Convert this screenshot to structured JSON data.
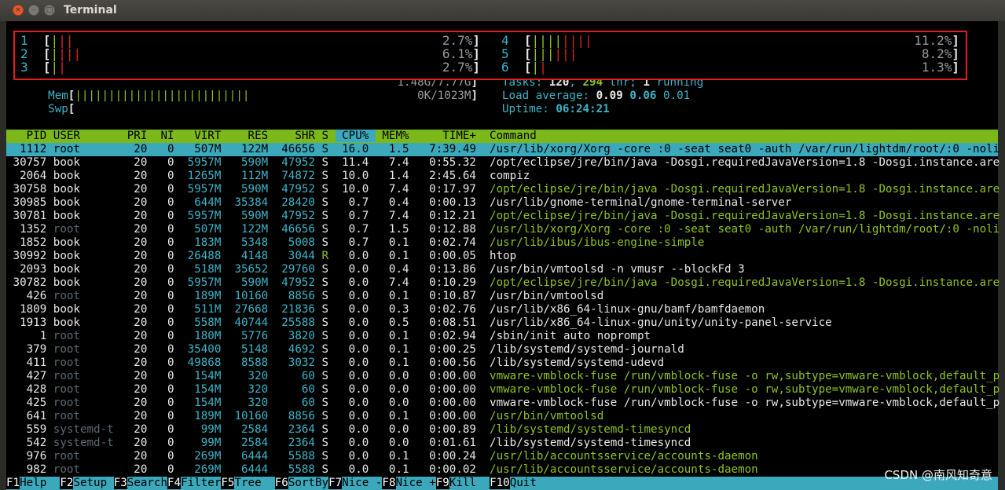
{
  "window": {
    "title": "Terminal",
    "buttons": {
      "close": "×",
      "minimize": "–",
      "maximize": "□"
    }
  },
  "meters": {
    "cpus": [
      {
        "id": "1",
        "bar": "|||",
        "percent": "2.7%"
      },
      {
        "id": "2",
        "bar": "||||",
        "percent": "6.1%"
      },
      {
        "id": "3",
        "bar": "||",
        "percent": "2.7%"
      },
      {
        "id": "4",
        "bar": "||||||||",
        "percent": "11.2%"
      },
      {
        "id": "5",
        "bar": "||||||",
        "percent": "8.2%"
      },
      {
        "id": "6",
        "bar": "||",
        "percent": "1.3%"
      }
    ],
    "mem": {
      "label": "Mem",
      "bar": "||||||||||||||||||||||||||",
      "value": "1.48G/7.77G"
    },
    "swp": {
      "label": "Swp",
      "value": "0K/1023M"
    },
    "tasks": {
      "label": "Tasks: ",
      "count": "120",
      "sep1": ", ",
      "threads": "294",
      "thr_label": " thr; ",
      "running": "1",
      "running_label": " running"
    },
    "load": {
      "label": "Load average: ",
      "l1": "0.09",
      "l5": "0.06",
      "l15": "0.01"
    },
    "uptime": {
      "label": "Uptime: ",
      "value": "06:24:21"
    }
  },
  "columns": [
    "PID",
    "USER",
    "PRI",
    "NI",
    "VIRT",
    "RES",
    "SHR",
    "S",
    "CPU%",
    "MEM%",
    "TIME+",
    "Command"
  ],
  "processes": [
    {
      "pid": "1112",
      "user": "root",
      "pri": "20",
      "ni": "0",
      "virt": "507M",
      "res": "122M",
      "shr": "46656",
      "s": "S",
      "cpu": "16.0",
      "mem": "1.5",
      "time": "7:39.49",
      "cmd": "/usr/lib/xorg/Xorg -core :0 -seat seat0 -auth /var/run/lightdm/root/:0 -noli",
      "kind": "selected"
    },
    {
      "pid": "30757",
      "user": "book",
      "pri": "20",
      "ni": "0",
      "virt": "5957M",
      "res": "590M",
      "shr": "47952",
      "s": "S",
      "cpu": "11.4",
      "mem": "7.4",
      "time": "0:55.32",
      "cmd": "/opt/eclipse/jre/bin/java -Dosgi.requiredJavaVersion=1.8 -Dosgi.instance.are",
      "kind": "normal"
    },
    {
      "pid": "2064",
      "user": "book",
      "pri": "20",
      "ni": "0",
      "virt": "1265M",
      "res": "112M",
      "shr": "74872",
      "s": "S",
      "cpu": "10.0",
      "mem": "1.4",
      "time": "2:45.64",
      "cmd": "compiz",
      "kind": "normal"
    },
    {
      "pid": "30758",
      "user": "book",
      "pri": "20",
      "ni": "0",
      "virt": "5957M",
      "res": "590M",
      "shr": "47952",
      "s": "S",
      "cpu": "10.0",
      "mem": "7.4",
      "time": "0:17.97",
      "cmd": "/opt/eclipse/jre/bin/java -Dosgi.requiredJavaVersion=1.8 -Dosgi.instance.are",
      "kind": "thread"
    },
    {
      "pid": "30985",
      "user": "book",
      "pri": "20",
      "ni": "0",
      "virt": "644M",
      "res": "35384",
      "shr": "28420",
      "s": "S",
      "cpu": "0.7",
      "mem": "0.4",
      "time": "0:00.13",
      "cmd": "/usr/lib/gnome-terminal/gnome-terminal-server",
      "kind": "normal"
    },
    {
      "pid": "30781",
      "user": "book",
      "pri": "20",
      "ni": "0",
      "virt": "5957M",
      "res": "590M",
      "shr": "47952",
      "s": "S",
      "cpu": "0.7",
      "mem": "7.4",
      "time": "0:12.21",
      "cmd": "/opt/eclipse/jre/bin/java -Dosgi.requiredJavaVersion=1.8 -Dosgi.instance.are",
      "kind": "thread"
    },
    {
      "pid": "1352",
      "user": "root",
      "pri": "20",
      "ni": "0",
      "virt": "507M",
      "res": "122M",
      "shr": "46656",
      "s": "S",
      "cpu": "0.7",
      "mem": "1.5",
      "time": "0:12.88",
      "cmd": "/usr/lib/xorg/Xorg -core :0 -seat seat0 -auth /var/run/lightdm/root/:0 -noli",
      "kind": "thread"
    },
    {
      "pid": "1852",
      "user": "book",
      "pri": "20",
      "ni": "0",
      "virt": "183M",
      "res": "5348",
      "shr": "5008",
      "s": "S",
      "cpu": "0.7",
      "mem": "0.1",
      "time": "0:02.74",
      "cmd": "/usr/lib/ibus/ibus-engine-simple",
      "kind": "thread"
    },
    {
      "pid": "30992",
      "user": "book",
      "pri": "20",
      "ni": "0",
      "virt": "26488",
      "res": "4148",
      "shr": "3044",
      "s": "R",
      "cpu": "0.0",
      "mem": "0.1",
      "time": "0:00.05",
      "cmd": "htop",
      "kind": "normal"
    },
    {
      "pid": "2093",
      "user": "book",
      "pri": "20",
      "ni": "0",
      "virt": "518M",
      "res": "35652",
      "shr": "29760",
      "s": "S",
      "cpu": "0.0",
      "mem": "0.4",
      "time": "0:13.86",
      "cmd": "/usr/bin/vmtoolsd -n vmusr --blockFd 3",
      "kind": "normal"
    },
    {
      "pid": "30782",
      "user": "book",
      "pri": "20",
      "ni": "0",
      "virt": "5957M",
      "res": "590M",
      "shr": "47952",
      "s": "S",
      "cpu": "0.0",
      "mem": "7.4",
      "time": "0:10.29",
      "cmd": "/opt/eclipse/jre/bin/java -Dosgi.requiredJavaVersion=1.8 -Dosgi.instance.are",
      "kind": "thread"
    },
    {
      "pid": "426",
      "user": "root",
      "pri": "20",
      "ni": "0",
      "virt": "189M",
      "res": "10160",
      "shr": "8856",
      "s": "S",
      "cpu": "0.0",
      "mem": "0.1",
      "time": "0:10.87",
      "cmd": "/usr/bin/vmtoolsd",
      "kind": "normal"
    },
    {
      "pid": "1809",
      "user": "book",
      "pri": "20",
      "ni": "0",
      "virt": "511M",
      "res": "27668",
      "shr": "21836",
      "s": "S",
      "cpu": "0.0",
      "mem": "0.3",
      "time": "0:02.76",
      "cmd": "/usr/lib/x86_64-linux-gnu/bamf/bamfdaemon",
      "kind": "normal"
    },
    {
      "pid": "1913",
      "user": "book",
      "pri": "20",
      "ni": "0",
      "virt": "558M",
      "res": "40744",
      "shr": "25588",
      "s": "S",
      "cpu": "0.0",
      "mem": "0.5",
      "time": "0:08.51",
      "cmd": "/usr/lib/x86_64-linux-gnu/unity/unity-panel-service",
      "kind": "normal"
    },
    {
      "pid": "1",
      "user": "root",
      "pri": "20",
      "ni": "0",
      "virt": "180M",
      "res": "5776",
      "shr": "3820",
      "s": "S",
      "cpu": "0.0",
      "mem": "0.1",
      "time": "0:02.94",
      "cmd": "/sbin/init auto noprompt",
      "kind": "normal"
    },
    {
      "pid": "379",
      "user": "root",
      "pri": "20",
      "ni": "0",
      "virt": "35400",
      "res": "5148",
      "shr": "4692",
      "s": "S",
      "cpu": "0.0",
      "mem": "0.1",
      "time": "0:00.25",
      "cmd": "/lib/systemd/systemd-journald",
      "kind": "normal"
    },
    {
      "pid": "411",
      "user": "root",
      "pri": "20",
      "ni": "0",
      "virt": "49868",
      "res": "8588",
      "shr": "3032",
      "s": "S",
      "cpu": "0.0",
      "mem": "0.1",
      "time": "0:00.56",
      "cmd": "/lib/systemd/systemd-udevd",
      "kind": "normal"
    },
    {
      "pid": "427",
      "user": "root",
      "pri": "20",
      "ni": "0",
      "virt": "154M",
      "res": "320",
      "shr": "60",
      "s": "S",
      "cpu": "0.0",
      "mem": "0.0",
      "time": "0:00.00",
      "cmd": "vmware-vmblock-fuse /run/vmblock-fuse -o rw,subtype=vmware-vmblock,default_p",
      "kind": "thread"
    },
    {
      "pid": "428",
      "user": "root",
      "pri": "20",
      "ni": "0",
      "virt": "154M",
      "res": "320",
      "shr": "60",
      "s": "S",
      "cpu": "0.0",
      "mem": "0.0",
      "time": "0:00.00",
      "cmd": "vmware-vmblock-fuse /run/vmblock-fuse -o rw,subtype=vmware-vmblock,default_p",
      "kind": "thread"
    },
    {
      "pid": "425",
      "user": "root",
      "pri": "20",
      "ni": "0",
      "virt": "154M",
      "res": "320",
      "shr": "60",
      "s": "S",
      "cpu": "0.0",
      "mem": "0.0",
      "time": "0:00.00",
      "cmd": "vmware-vmblock-fuse /run/vmblock-fuse -o rw,subtype=vmware-vmblock,default_p",
      "kind": "normal"
    },
    {
      "pid": "641",
      "user": "root",
      "pri": "20",
      "ni": "0",
      "virt": "189M",
      "res": "10160",
      "shr": "8856",
      "s": "S",
      "cpu": "0.0",
      "mem": "0.1",
      "time": "0:00.00",
      "cmd": "/usr/bin/vmtoolsd",
      "kind": "thread"
    },
    {
      "pid": "559",
      "user": "systemd-t",
      "pri": "20",
      "ni": "0",
      "virt": "99M",
      "res": "2584",
      "shr": "2364",
      "s": "S",
      "cpu": "0.0",
      "mem": "0.0",
      "time": "0:00.89",
      "cmd": "/lib/systemd/systemd-timesyncd",
      "kind": "thread"
    },
    {
      "pid": "542",
      "user": "systemd-t",
      "pri": "20",
      "ni": "0",
      "virt": "99M",
      "res": "2584",
      "shr": "2364",
      "s": "S",
      "cpu": "0.0",
      "mem": "0.0",
      "time": "0:01.61",
      "cmd": "/lib/systemd/systemd-timesyncd",
      "kind": "normal"
    },
    {
      "pid": "976",
      "user": "root",
      "pri": "20",
      "ni": "0",
      "virt": "269M",
      "res": "6444",
      "shr": "5588",
      "s": "S",
      "cpu": "0.0",
      "mem": "0.1",
      "time": "0:00.24",
      "cmd": "/usr/lib/accountsservice/accounts-daemon",
      "kind": "thread"
    },
    {
      "pid": "982",
      "user": "root",
      "pri": "20",
      "ni": "0",
      "virt": "269M",
      "res": "6444",
      "shr": "5588",
      "s": "S",
      "cpu": "0.0",
      "mem": "0.1",
      "time": "0:00.02",
      "cmd": "/usr/lib/accountsservice/accounts-daemon",
      "kind": "thread"
    }
  ],
  "function_keys": [
    {
      "key": "F1",
      "label": "Help  "
    },
    {
      "key": "F2",
      "label": "Setup "
    },
    {
      "key": "F3",
      "label": "Search"
    },
    {
      "key": "F4",
      "label": "Filter"
    },
    {
      "key": "F5",
      "label": "Tree  "
    },
    {
      "key": "F6",
      "label": "SortBy"
    },
    {
      "key": "F7",
      "label": "Nice -"
    },
    {
      "key": "F8",
      "label": "Nice +"
    },
    {
      "key": "F9",
      "label": "Kill  "
    },
    {
      "key": "F10",
      "label": "Quit"
    }
  ],
  "watermark": "CSDN @南风知奇意",
  "colors": {
    "highlight_box": "#e02020",
    "header_bg": "#7cb81a",
    "selected_bg": "#3ba9bb",
    "thread_text": "#8fc320"
  }
}
